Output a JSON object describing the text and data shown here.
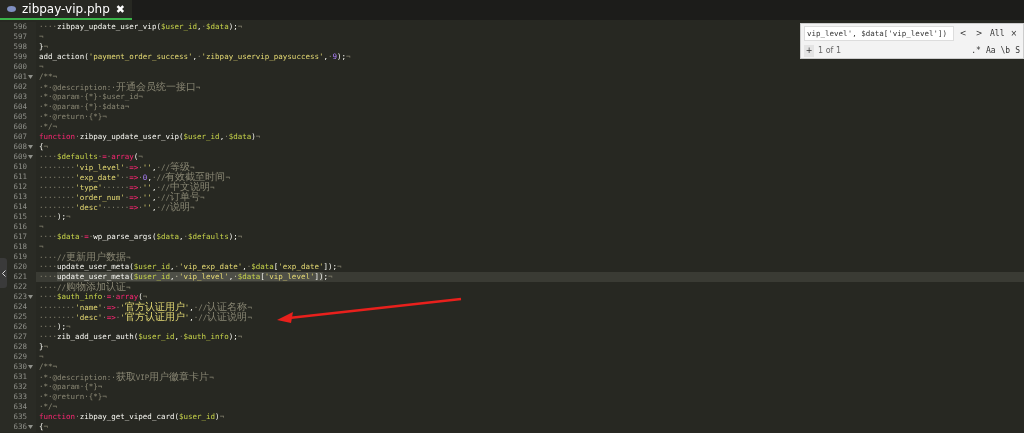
{
  "tab": {
    "title": "zibpay-vip.php",
    "close": "✖",
    "selected": true
  },
  "search": {
    "value": "vip_level', $data['vip_level'])",
    "prev": "<",
    "next": ">",
    "all": "All",
    "close": "×",
    "add": "+",
    "count": "1 of 1",
    "options": [
      ".*",
      "Aa",
      "\\b",
      "S"
    ]
  },
  "lines": [
    {
      "number": "596",
      "fold": false,
      "current": false,
      "tokens": [
        {
          "kind": "space",
          "text": "····"
        },
        {
          "kind": "plain",
          "text": "zibpay_update_user_vip("
        },
        {
          "kind": "variable",
          "text": "$user_id"
        },
        {
          "kind": "plain",
          "text": ","
        },
        {
          "kind": "space",
          "text": "·"
        },
        {
          "kind": "variable",
          "text": "$data"
        },
        {
          "kind": "plain",
          "text": ");"
        },
        {
          "kind": "space",
          "text": "¬"
        }
      ]
    },
    {
      "number": "597",
      "fold": false,
      "current": false,
      "tokens": [
        {
          "kind": "space",
          "text": "¬"
        }
      ]
    },
    {
      "number": "598",
      "fold": false,
      "current": false,
      "tokens": [
        {
          "kind": "plain",
          "text": "}"
        },
        {
          "kind": "space",
          "text": "¬"
        }
      ]
    },
    {
      "number": "599",
      "fold": false,
      "current": false,
      "tokens": [
        {
          "kind": "plain",
          "text": "add_action("
        },
        {
          "kind": "string",
          "text": "'payment_order_success'"
        },
        {
          "kind": "plain",
          "text": ","
        },
        {
          "kind": "space",
          "text": "·"
        },
        {
          "kind": "string",
          "text": "'zibpay_uservip_paysuccess'"
        },
        {
          "kind": "plain",
          "text": ","
        },
        {
          "kind": "space",
          "text": "·"
        },
        {
          "kind": "number",
          "text": "9"
        },
        {
          "kind": "plain",
          "text": ");"
        },
        {
          "kind": "space",
          "text": "¬"
        }
      ]
    },
    {
      "number": "600",
      "fold": false,
      "current": false,
      "tokens": [
        {
          "kind": "space",
          "text": "¬"
        }
      ]
    },
    {
      "number": "601",
      "fold": true,
      "current": false,
      "tokens": [
        {
          "kind": "comment",
          "text": "/**¬"
        }
      ]
    },
    {
      "number": "602",
      "fold": false,
      "current": false,
      "tokens": [
        {
          "kind": "comment",
          "text": "·*·@description:·开通会员统一接口¬"
        }
      ]
    },
    {
      "number": "603",
      "fold": false,
      "current": false,
      "tokens": [
        {
          "kind": "comment",
          "text": "·*·@param·{*}·$user_id¬"
        }
      ]
    },
    {
      "number": "604",
      "fold": false,
      "current": false,
      "tokens": [
        {
          "kind": "comment",
          "text": "·*·@param·{*}·$data¬"
        }
      ]
    },
    {
      "number": "605",
      "fold": false,
      "current": false,
      "tokens": [
        {
          "kind": "comment",
          "text": "·*·@return·{*}¬"
        }
      ]
    },
    {
      "number": "606",
      "fold": false,
      "current": false,
      "tokens": [
        {
          "kind": "comment",
          "text": "·*/¬"
        }
      ]
    },
    {
      "number": "607",
      "fold": false,
      "current": false,
      "tokens": [
        {
          "kind": "keyword",
          "text": "function"
        },
        {
          "kind": "space",
          "text": "·"
        },
        {
          "kind": "plain",
          "text": "zibpay_update_user_vip("
        },
        {
          "kind": "variable",
          "text": "$user_id"
        },
        {
          "kind": "plain",
          "text": ","
        },
        {
          "kind": "space",
          "text": "·"
        },
        {
          "kind": "variable",
          "text": "$data"
        },
        {
          "kind": "plain",
          "text": ")"
        },
        {
          "kind": "space",
          "text": "¬"
        }
      ]
    },
    {
      "number": "608",
      "fold": true,
      "current": false,
      "tokens": [
        {
          "kind": "plain",
          "text": "{"
        },
        {
          "kind": "space",
          "text": "¬"
        }
      ]
    },
    {
      "number": "609",
      "fold": true,
      "current": false,
      "tokens": [
        {
          "kind": "space",
          "text": "····"
        },
        {
          "kind": "variable",
          "text": "$defaults"
        },
        {
          "kind": "space",
          "text": "·"
        },
        {
          "kind": "keyword",
          "text": "="
        },
        {
          "kind": "space",
          "text": "·"
        },
        {
          "kind": "keyword",
          "text": "array"
        },
        {
          "kind": "plain",
          "text": "("
        },
        {
          "kind": "space",
          "text": "¬"
        }
      ]
    },
    {
      "number": "610",
      "fold": false,
      "current": false,
      "tokens": [
        {
          "kind": "space",
          "text": "········"
        },
        {
          "kind": "string",
          "text": "'vip_level'"
        },
        {
          "kind": "space",
          "text": "·"
        },
        {
          "kind": "keyword",
          "text": "=>"
        },
        {
          "kind": "space",
          "text": "·"
        },
        {
          "kind": "string",
          "text": "''"
        },
        {
          "kind": "plain",
          "text": ","
        },
        {
          "kind": "space",
          "text": "·"
        },
        {
          "kind": "comment",
          "text": "//等级¬"
        }
      ]
    },
    {
      "number": "611",
      "fold": false,
      "current": false,
      "tokens": [
        {
          "kind": "space",
          "text": "········"
        },
        {
          "kind": "string",
          "text": "'exp_date'"
        },
        {
          "kind": "space",
          "text": "··"
        },
        {
          "kind": "keyword",
          "text": "=>"
        },
        {
          "kind": "space",
          "text": "·"
        },
        {
          "kind": "number",
          "text": "0"
        },
        {
          "kind": "plain",
          "text": ","
        },
        {
          "kind": "space",
          "text": "·"
        },
        {
          "kind": "comment",
          "text": "//有效截至时间¬"
        }
      ]
    },
    {
      "number": "612",
      "fold": false,
      "current": false,
      "tokens": [
        {
          "kind": "space",
          "text": "········"
        },
        {
          "kind": "string",
          "text": "'type'"
        },
        {
          "kind": "space",
          "text": "······"
        },
        {
          "kind": "keyword",
          "text": "=>"
        },
        {
          "kind": "space",
          "text": "·"
        },
        {
          "kind": "string",
          "text": "''"
        },
        {
          "kind": "plain",
          "text": ","
        },
        {
          "kind": "space",
          "text": "·"
        },
        {
          "kind": "comment",
          "text": "//中文说明¬"
        }
      ]
    },
    {
      "number": "613",
      "fold": false,
      "current": false,
      "tokens": [
        {
          "kind": "space",
          "text": "········"
        },
        {
          "kind": "string",
          "text": "'order_num'"
        },
        {
          "kind": "space",
          "text": "·"
        },
        {
          "kind": "keyword",
          "text": "=>"
        },
        {
          "kind": "space",
          "text": "·"
        },
        {
          "kind": "string",
          "text": "''"
        },
        {
          "kind": "plain",
          "text": ","
        },
        {
          "kind": "space",
          "text": "·"
        },
        {
          "kind": "comment",
          "text": "//订单号¬"
        }
      ]
    },
    {
      "number": "614",
      "fold": false,
      "current": false,
      "tokens": [
        {
          "kind": "space",
          "text": "········"
        },
        {
          "kind": "string",
          "text": "'desc'"
        },
        {
          "kind": "space",
          "text": "······"
        },
        {
          "kind": "keyword",
          "text": "=>"
        },
        {
          "kind": "space",
          "text": "·"
        },
        {
          "kind": "string",
          "text": "''"
        },
        {
          "kind": "plain",
          "text": ","
        },
        {
          "kind": "space",
          "text": "·"
        },
        {
          "kind": "comment",
          "text": "//说明¬"
        }
      ]
    },
    {
      "number": "615",
      "fold": false,
      "current": false,
      "tokens": [
        {
          "kind": "space",
          "text": "····"
        },
        {
          "kind": "plain",
          "text": ");"
        },
        {
          "kind": "space",
          "text": "¬"
        }
      ]
    },
    {
      "number": "616",
      "fold": false,
      "current": false,
      "tokens": [
        {
          "kind": "space",
          "text": "¬"
        }
      ]
    },
    {
      "number": "617",
      "fold": false,
      "current": false,
      "tokens": [
        {
          "kind": "space",
          "text": "····"
        },
        {
          "kind": "variable",
          "text": "$data"
        },
        {
          "kind": "space",
          "text": "·"
        },
        {
          "kind": "keyword",
          "text": "="
        },
        {
          "kind": "space",
          "text": "·"
        },
        {
          "kind": "plain",
          "text": "wp_parse_args("
        },
        {
          "kind": "variable",
          "text": "$data"
        },
        {
          "kind": "plain",
          "text": ","
        },
        {
          "kind": "space",
          "text": "·"
        },
        {
          "kind": "variable",
          "text": "$defaults"
        },
        {
          "kind": "plain",
          "text": ");"
        },
        {
          "kind": "space",
          "text": "¬"
        }
      ]
    },
    {
      "number": "618",
      "fold": false,
      "current": false,
      "tokens": [
        {
          "kind": "space",
          "text": "¬"
        }
      ]
    },
    {
      "number": "619",
      "fold": false,
      "current": false,
      "tokens": [
        {
          "kind": "space",
          "text": "····"
        },
        {
          "kind": "comment",
          "text": "//更新用户数据¬"
        }
      ]
    },
    {
      "number": "620",
      "fold": false,
      "current": false,
      "tokens": [
        {
          "kind": "space",
          "text": "····"
        },
        {
          "kind": "plain",
          "text": "update_user_meta("
        },
        {
          "kind": "variable",
          "text": "$user_id"
        },
        {
          "kind": "plain",
          "text": ","
        },
        {
          "kind": "space",
          "text": "·"
        },
        {
          "kind": "string",
          "text": "'vip_exp_date'"
        },
        {
          "kind": "plain",
          "text": ","
        },
        {
          "kind": "space",
          "text": "·"
        },
        {
          "kind": "variable",
          "text": "$data"
        },
        {
          "kind": "plain",
          "text": "["
        },
        {
          "kind": "string",
          "text": "'exp_date'"
        },
        {
          "kind": "plain",
          "text": "]);"
        },
        {
          "kind": "space",
          "text": "¬"
        }
      ]
    },
    {
      "number": "621",
      "fold": false,
      "current": true,
      "tokens": [
        {
          "kind": "space",
          "text": "····"
        }
      ],
      "selection": [
        {
          "kind": "plain",
          "text": "update_user_meta("
        },
        {
          "kind": "variable",
          "text": "$user_id"
        },
        {
          "kind": "plain",
          "text": ","
        },
        {
          "kind": "space",
          "text": "·"
        },
        {
          "kind": "string",
          "text": "'vip_level'"
        },
        {
          "kind": "plain",
          "text": ","
        },
        {
          "kind": "space",
          "text": "·"
        },
        {
          "kind": "variable",
          "text": "$data"
        },
        {
          "kind": "plain",
          "text": "["
        },
        {
          "kind": "string",
          "text": "'vip_level'"
        },
        {
          "kind": "plain",
          "text": "])"
        }
      ],
      "tokens_after": [
        {
          "kind": "plain",
          "text": ";"
        },
        {
          "kind": "space",
          "text": "¬"
        }
      ]
    },
    {
      "number": "622",
      "fold": false,
      "current": false,
      "tokens": [
        {
          "kind": "space",
          "text": "····"
        },
        {
          "kind": "comment",
          "text": "//购物添加认证¬"
        }
      ]
    },
    {
      "number": "623",
      "fold": true,
      "current": false,
      "tokens": [
        {
          "kind": "space",
          "text": "····"
        },
        {
          "kind": "variable",
          "text": "$auth_info"
        },
        {
          "kind": "space",
          "text": "·"
        },
        {
          "kind": "keyword",
          "text": "="
        },
        {
          "kind": "space",
          "text": "·"
        },
        {
          "kind": "keyword",
          "text": "array"
        },
        {
          "kind": "plain",
          "text": "("
        },
        {
          "kind": "space",
          "text": "¬"
        }
      ]
    },
    {
      "number": "624",
      "fold": false,
      "current": false,
      "tokens": [
        {
          "kind": "space",
          "text": "········"
        },
        {
          "kind": "string",
          "text": "'name'"
        },
        {
          "kind": "space",
          "text": "·"
        },
        {
          "kind": "keyword",
          "text": "=>"
        },
        {
          "kind": "space",
          "text": "·"
        },
        {
          "kind": "string",
          "text": "'官方认证用户'"
        },
        {
          "kind": "plain",
          "text": ","
        },
        {
          "kind": "space",
          "text": "·"
        },
        {
          "kind": "comment",
          "text": "//认证名称¬"
        }
      ]
    },
    {
      "number": "625",
      "fold": false,
      "current": false,
      "tokens": [
        {
          "kind": "space",
          "text": "········"
        },
        {
          "kind": "string",
          "text": "'desc'"
        },
        {
          "kind": "space",
          "text": "·"
        },
        {
          "kind": "keyword",
          "text": "=>"
        },
        {
          "kind": "space",
          "text": "·"
        },
        {
          "kind": "string",
          "text": "'官方认证用户'"
        },
        {
          "kind": "plain",
          "text": ","
        },
        {
          "kind": "space",
          "text": "·"
        },
        {
          "kind": "comment",
          "text": "//认证说明¬"
        }
      ]
    },
    {
      "number": "626",
      "fold": false,
      "current": false,
      "tokens": [
        {
          "kind": "space",
          "text": "····"
        },
        {
          "kind": "plain",
          "text": ");"
        },
        {
          "kind": "space",
          "text": "¬"
        }
      ]
    },
    {
      "number": "627",
      "fold": false,
      "current": false,
      "tokens": [
        {
          "kind": "space",
          "text": "····"
        },
        {
          "kind": "plain",
          "text": "zib_add_user_auth("
        },
        {
          "kind": "variable",
          "text": "$user_id"
        },
        {
          "kind": "plain",
          "text": ","
        },
        {
          "kind": "space",
          "text": "·"
        },
        {
          "kind": "variable",
          "text": "$auth_info"
        },
        {
          "kind": "plain",
          "text": ");"
        },
        {
          "kind": "space",
          "text": "¬"
        }
      ]
    },
    {
      "number": "628",
      "fold": false,
      "current": false,
      "tokens": [
        {
          "kind": "plain",
          "text": "}"
        },
        {
          "kind": "space",
          "text": "¬"
        }
      ]
    },
    {
      "number": "629",
      "fold": false,
      "current": false,
      "tokens": [
        {
          "kind": "space",
          "text": "¬"
        }
      ]
    },
    {
      "number": "630",
      "fold": true,
      "current": false,
      "tokens": [
        {
          "kind": "comment",
          "text": "/**¬"
        }
      ]
    },
    {
      "number": "631",
      "fold": false,
      "current": false,
      "tokens": [
        {
          "kind": "comment",
          "text": "·*·@description:·获取VIP用户徽章卡片¬"
        }
      ]
    },
    {
      "number": "632",
      "fold": false,
      "current": false,
      "tokens": [
        {
          "kind": "comment",
          "text": "·*·@param·{*}¬"
        }
      ]
    },
    {
      "number": "633",
      "fold": false,
      "current": false,
      "tokens": [
        {
          "kind": "comment",
          "text": "·*·@return·{*}¬"
        }
      ]
    },
    {
      "number": "634",
      "fold": false,
      "current": false,
      "tokens": [
        {
          "kind": "comment",
          "text": "·*/¬"
        }
      ]
    },
    {
      "number": "635",
      "fold": false,
      "current": false,
      "tokens": [
        {
          "kind": "keyword",
          "text": "function"
        },
        {
          "kind": "space",
          "text": "·"
        },
        {
          "kind": "plain",
          "text": "zibpay_get_viped_card("
        },
        {
          "kind": "variable",
          "text": "$user_id"
        },
        {
          "kind": "plain",
          "text": ")"
        },
        {
          "kind": "space",
          "text": "¬"
        }
      ]
    },
    {
      "number": "636",
      "fold": true,
      "current": false,
      "tokens": [
        {
          "kind": "plain",
          "text": "{"
        },
        {
          "kind": "space",
          "text": "¬"
        }
      ]
    }
  ]
}
